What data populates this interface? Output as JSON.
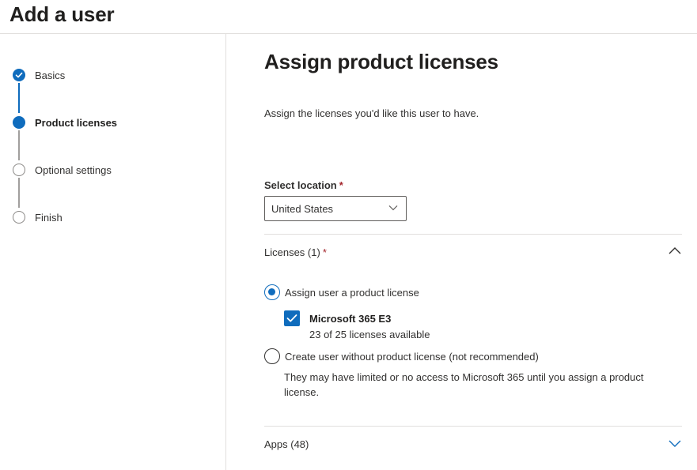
{
  "page": {
    "title": "Add a user"
  },
  "steps": [
    {
      "label": "Basics",
      "state": "done"
    },
    {
      "label": "Product licenses",
      "state": "current"
    },
    {
      "label": "Optional settings",
      "state": "todo"
    },
    {
      "label": "Finish",
      "state": "todo"
    }
  ],
  "main": {
    "heading": "Assign product licenses",
    "intro": "Assign the licenses you'd like this user to have.",
    "location": {
      "label": "Select location",
      "required_mark": "*",
      "selected": "United States"
    },
    "licenses": {
      "header": "Licenses (1)",
      "required_mark": "*",
      "expanded": true,
      "assign_option": "Assign user a product license",
      "product": {
        "name": "Microsoft 365 E3",
        "availability": "23 of 25 licenses available",
        "checked": true
      },
      "no_license_option": "Create user without product license (not recommended)",
      "no_license_note": "They may have limited or no access to Microsoft 365 until you assign a product license."
    },
    "apps": {
      "header": "Apps (48)",
      "expanded": false
    }
  },
  "colors": {
    "accent": "#0f6cbd",
    "required": "#a4262c",
    "divider": "#e1dfdd"
  }
}
